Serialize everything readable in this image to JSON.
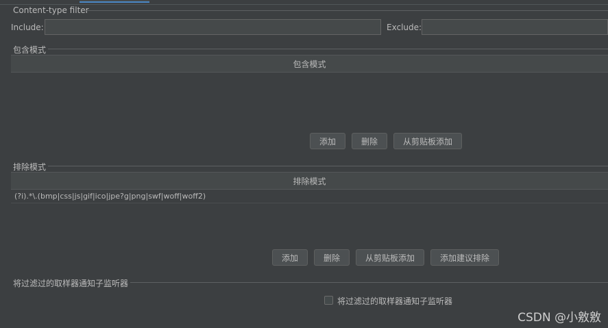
{
  "content_type_filter": {
    "title": "Content-type filter",
    "include_label": "Include:",
    "include_value": "",
    "exclude_label": "Exclude:",
    "exclude_value": ""
  },
  "include_patterns": {
    "title": "包含模式",
    "column_header": "包含模式",
    "rows": [],
    "buttons": {
      "add": "添加",
      "delete": "删除",
      "add_from_clipboard": "从剪贴板添加"
    }
  },
  "exclude_patterns": {
    "title": "排除模式",
    "column_header": "排除模式",
    "rows": [
      "(?i).*\\.(bmp|css|js|gif|ico|jpe?g|png|swf|woff|woff2)"
    ],
    "buttons": {
      "add": "添加",
      "delete": "删除",
      "add_from_clipboard": "从剪贴板添加",
      "add_suggested": "添加建议排除"
    }
  },
  "notify_child": {
    "title": "将过滤过的取样器通知子监听器",
    "checkbox_label": "将过滤过的取样器通知子监听器",
    "checked": false
  },
  "watermark": "CSDN @小敫敫"
}
